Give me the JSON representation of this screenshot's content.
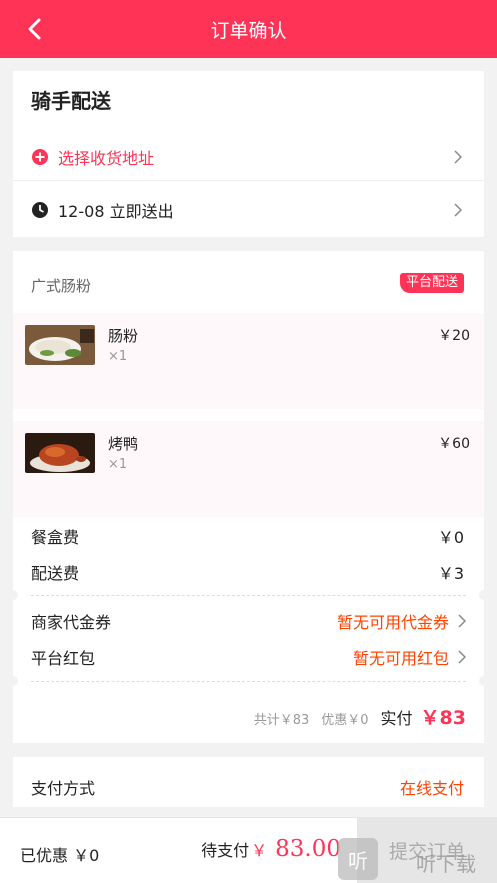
{
  "header": {
    "title": "订单确认"
  },
  "delivery": {
    "title": "骑手配送",
    "address_label": "选择收货地址",
    "time_label": "12-08 立即送出"
  },
  "order": {
    "shop_name": "广式肠粉",
    "delivery_tag": "平台配送",
    "items": [
      {
        "name": "肠粉",
        "qty": "×1",
        "price": "￥20"
      },
      {
        "name": "烤鸭",
        "qty": "×1",
        "price": "￥60"
      }
    ],
    "fees": [
      {
        "label": "餐盒费",
        "value": "￥0"
      },
      {
        "label": "配送费",
        "value": "￥3"
      }
    ],
    "promos": [
      {
        "label": "商家代金券",
        "value": "暂无可用代金券"
      },
      {
        "label": "平台红包",
        "value": "暂无可用红包"
      }
    ],
    "summary": {
      "total_text": "共计￥83",
      "discount_text": "优惠￥0",
      "paid_label": "实付",
      "paid_value": "￥83"
    }
  },
  "payment": {
    "label": "支付方式",
    "value": "在线支付"
  },
  "bottom_bar": {
    "saved_text": "已优惠 ￥0",
    "due_label": "待支付",
    "currency": "￥",
    "due_amount": "83.00",
    "submit_label": "提交订单"
  },
  "watermark": {
    "badge": "听",
    "text": "听下载"
  },
  "colors": {
    "brand": "#ff3355",
    "accent": "#ff4400",
    "background": "#f2f2f2"
  }
}
